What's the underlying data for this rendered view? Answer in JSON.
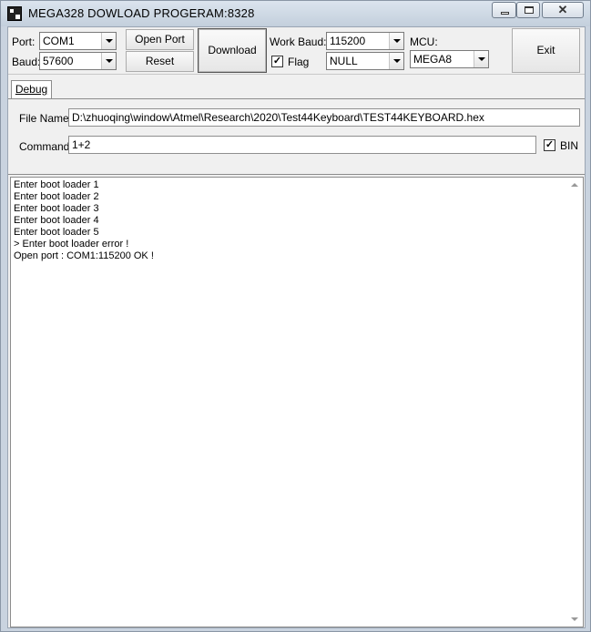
{
  "window": {
    "title": "MEGA328 DOWLOAD PROGERAM:8328",
    "min_icon": "minimize-icon",
    "max_icon": "maximize-icon",
    "close_icon": "close-icon"
  },
  "toolbar": {
    "port_label": "Port:",
    "port_value": "COM1",
    "baud_label": "Baud:",
    "baud_value": "57600",
    "open_port_label": "Open Port",
    "reset_label": "Reset",
    "download_label": "Download",
    "work_baud_label": "Work Baud:",
    "work_baud_value": "115200",
    "flag_label": "Flag",
    "flag_checked": "✓",
    "flag_combo_value": "NULL",
    "mcu_label": "MCU:",
    "mcu_value": "MEGA8",
    "exit_label": "Exit"
  },
  "tabs": [
    {
      "label": "Debug"
    }
  ],
  "debug": {
    "file_name_label": "File Name:",
    "file_name_value": "D:\\zhuoqing\\window\\Atmel\\Research\\2020\\Test44Keyboard\\TEST44KEYBOARD.hex",
    "command_label": "Command:",
    "command_value": "1+2",
    "bin_label": "BIN",
    "bin_checked": "✓"
  },
  "output": {
    "lines": [
      "Enter boot loader 1",
      "Enter boot loader 2",
      "Enter boot loader 3",
      "Enter boot loader 4",
      "Enter boot loader 5",
      "> Enter boot loader error !",
      "Open port : COM1:115200 OK !"
    ]
  }
}
